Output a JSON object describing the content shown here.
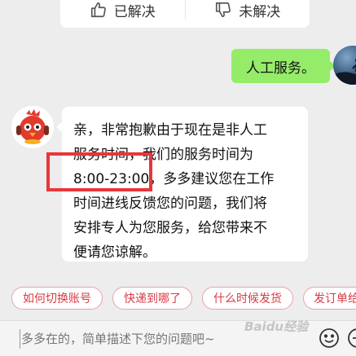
{
  "feedback": {
    "resolved_label": "已解决",
    "unresolved_label": "未解决"
  },
  "outgoing_message": {
    "text": "人工服务。"
  },
  "incoming_message": {
    "lines": [
      "亲，非常抱歉由于现在是非人工",
      "服务时间，我们的服务时间为",
      "8:00-23:00，多多建议您在工作",
      "时间进线反馈您的问题，我们将",
      "安排专人为您服务，给您带来不",
      "便请您谅解。"
    ]
  },
  "quick_replies": [
    "如何切换账号",
    "快递到哪了",
    "什么时候发货",
    "发订单给"
  ],
  "input": {
    "placeholder": "多多在的，简单描述下您的问题吧~"
  },
  "watermark": "Baidu经验",
  "colors": {
    "outgoing_bubble": "#95ec69",
    "chip_text": "#d93a44",
    "highlight": "#e8363a"
  },
  "icons": {
    "resolved": "thumbs-up-icon",
    "unresolved": "thumbs-down-icon",
    "emoji": "smiley-icon",
    "more": "plus-icon"
  }
}
